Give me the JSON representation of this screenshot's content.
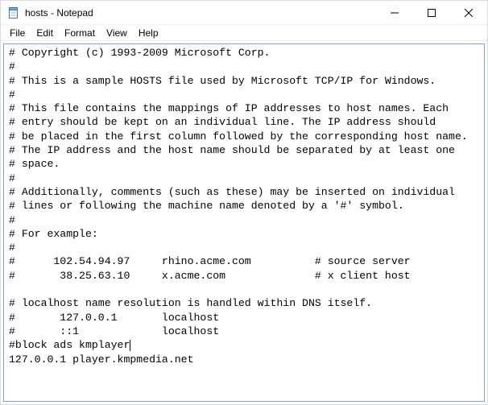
{
  "titlebar": {
    "title": "hosts - Notepad",
    "icon_name": "notepad-icon"
  },
  "window_controls": {
    "minimize": "Minimize",
    "maximize": "Maximize",
    "close": "Close"
  },
  "menubar": {
    "items": [
      {
        "label": "File"
      },
      {
        "label": "Edit"
      },
      {
        "label": "Format"
      },
      {
        "label": "View"
      },
      {
        "label": "Help"
      }
    ]
  },
  "editor": {
    "pre_caret": "# Copyright (c) 1993-2009 Microsoft Corp.\n#\n# This is a sample HOSTS file used by Microsoft TCP/IP for Windows.\n#\n# This file contains the mappings of IP addresses to host names. Each\n# entry should be kept on an individual line. The IP address should\n# be placed in the first column followed by the corresponding host name.\n# The IP address and the host name should be separated by at least one\n# space.\n#\n# Additionally, comments (such as these) may be inserted on individual\n# lines or following the machine name denoted by a '#' symbol.\n#\n# For example:\n#\n#      102.54.94.97     rhino.acme.com          # source server\n#       38.25.63.10     x.acme.com              # x client host\n\n# localhost name resolution is handled within DNS itself.\n#       127.0.0.1       localhost\n#       ::1             localhost\n#block ads kmplayer",
    "post_caret": "\n127.0.0.1 player.kmpmedia.net"
  }
}
